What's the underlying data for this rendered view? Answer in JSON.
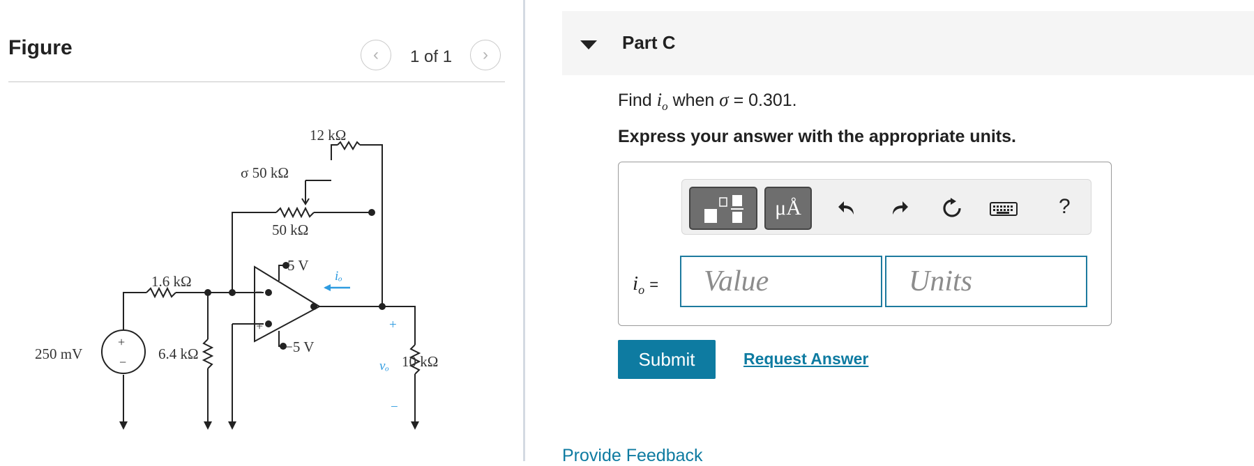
{
  "figure": {
    "title": "Figure",
    "pager": {
      "current": "1 of 1",
      "prev_icon": "chevron-left-icon",
      "next_icon": "chevron-right-icon"
    },
    "circuit": {
      "r_12k": "12 kΩ",
      "r_sigma": "σ 50 kΩ",
      "r_50k": "50 kΩ",
      "r_1_6k": "1.6 kΩ",
      "supply_pos": "5 V",
      "supply_neg": "−5 V",
      "current_label": "iₒ",
      "source": "250 mV",
      "r_6_4k": "6.4 kΩ",
      "r_10k": "10 kΩ",
      "vo_label": "vₒ",
      "plus": "+",
      "minus": "−"
    }
  },
  "part": {
    "title": "Part C",
    "question_prefix": "Find",
    "question_var": "i",
    "question_sub": "o",
    "question_mid": "when",
    "question_sigma": "σ",
    "question_eq": "= 0.301.",
    "instruction": "Express your answer with the appropriate units.",
    "toolbar": {
      "units_button": "μÅ",
      "help": "?"
    },
    "answer_label_var": "i",
    "answer_label_sub": "o",
    "answer_label_eq": "=",
    "value_placeholder": "Value",
    "units_placeholder": "Units",
    "submit": "Submit",
    "request_answer": "Request Answer"
  },
  "feedback_link": "Provide Feedback",
  "colors": {
    "accent": "#0e7ba1",
    "arrow_blue": "#2e9be0"
  }
}
